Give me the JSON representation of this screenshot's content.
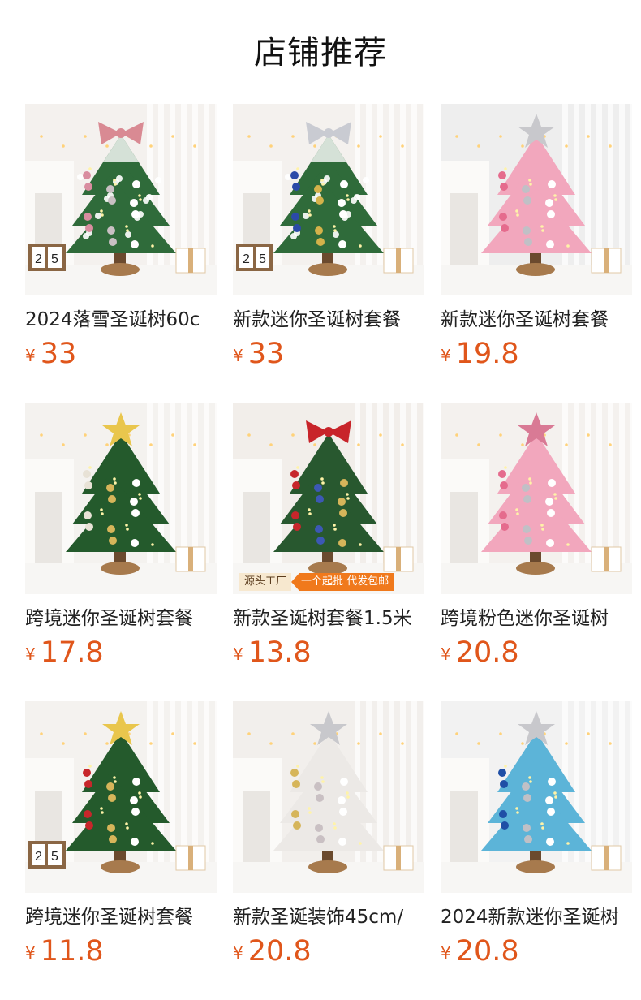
{
  "section": {
    "title": "店铺推荐"
  },
  "products": [
    {
      "name": "2024落雪圣诞树60c",
      "currency": "¥",
      "price": "33",
      "tree_color": "#2f6b3a",
      "snow": true,
      "topper": "bow-pink",
      "bg": "#f4f1ee",
      "ornaments": [
        "#d98da0",
        "#c9c0c3",
        "#ffffff"
      ],
      "calendar": "25"
    },
    {
      "name": "新款迷你圣诞树套餐",
      "currency": "¥",
      "price": "33",
      "tree_color": "#2f6b3a",
      "snow": true,
      "topper": "bow-silver",
      "bg": "#f4f1ee",
      "ornaments": [
        "#2b4aa8",
        "#d4b24a",
        "#ffffff"
      ],
      "calendar": "25"
    },
    {
      "name": "新款迷你圣诞树套餐",
      "currency": "¥",
      "price": "19.8",
      "tree_color": "#f2a7bd",
      "snow": false,
      "topper": "star-silver",
      "bg": "#eeeeee",
      "ornaments": [
        "#e56b8d",
        "#c0c0c6",
        "#ffffff"
      ],
      "calendar": ""
    },
    {
      "name": "跨境迷你圣诞树套餐",
      "currency": "¥",
      "price": "17.8",
      "tree_color": "#245a2c",
      "snow": false,
      "topper": "star-gold",
      "bg": "#f4f2ef",
      "ornaments": [
        "#e8e2d6",
        "#d6b55a",
        "#ffffff"
      ],
      "calendar": ""
    },
    {
      "name": "新款圣诞树套餐1.5米",
      "currency": "¥",
      "price": "13.8",
      "tree_color": "#28582f",
      "snow": false,
      "topper": "bow-red",
      "bg": "#f2eeea",
      "ornaments": [
        "#c7262b",
        "#3c58b5",
        "#d6b55a"
      ],
      "calendar": "",
      "promo": {
        "left": "源头工厂",
        "right": "一个起批 代发包邮"
      }
    },
    {
      "name": "跨境粉色迷你圣诞树",
      "currency": "¥",
      "price": "20.8",
      "tree_color": "#f2a7bd",
      "snow": false,
      "topper": "star-pink",
      "bg": "#f4f1ee",
      "ornaments": [
        "#e56b8d",
        "#c0c0c6",
        "#ffffff"
      ],
      "calendar": ""
    },
    {
      "name": "跨境迷你圣诞树套餐",
      "currency": "¥",
      "price": "11.8",
      "tree_color": "#245a2c",
      "snow": false,
      "topper": "star-gold",
      "bg": "#f4f2ef",
      "ornaments": [
        "#c7262b",
        "#d6b55a",
        "#ffffff"
      ],
      "calendar": "25"
    },
    {
      "name": "新款圣诞装饰45cm/",
      "currency": "¥",
      "price": "20.8",
      "tree_color": "#ece9e6",
      "snow": false,
      "topper": "star-silver",
      "bg": "#f2efec",
      "ornaments": [
        "#d6b55a",
        "#c9c0c3",
        "#ffffff"
      ],
      "calendar": ""
    },
    {
      "name": "2024新款迷你圣诞树",
      "currency": "¥",
      "price": "20.8",
      "tree_color": "#5cb4d8",
      "snow": false,
      "topper": "star-silver",
      "bg": "#f2f2f2",
      "ornaments": [
        "#1f4fa6",
        "#c0c0c6",
        "#ffffff"
      ],
      "calendar": ""
    }
  ]
}
